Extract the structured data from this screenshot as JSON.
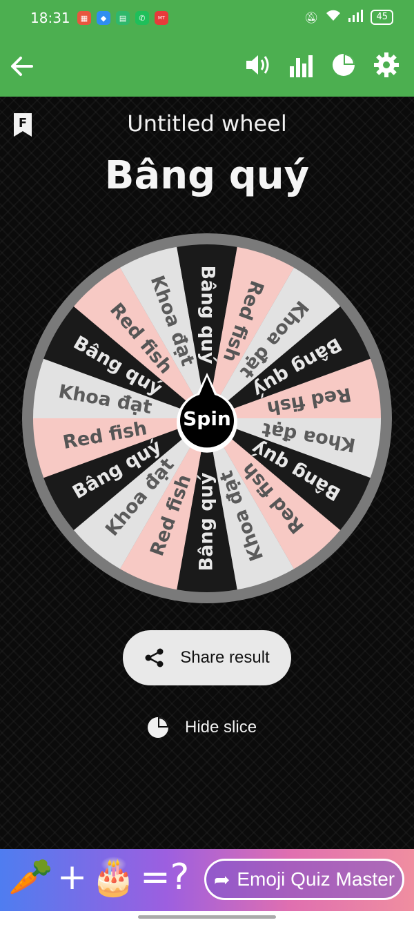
{
  "status_bar": {
    "time": "18:31",
    "battery": "45",
    "notification_icons": [
      "photos-icon",
      "browser-icon",
      "app-icon",
      "phone-icon",
      "mangatoon-icon"
    ]
  },
  "app_bar": {
    "back_icon": "arrow-left-icon",
    "actions": [
      "volume-icon",
      "stats-icon",
      "pie-chart-icon",
      "settings-icon"
    ],
    "color": "#4caf50"
  },
  "wheel": {
    "title": "Untitled wheel",
    "result": "Bâng quý",
    "spin_label": "Spin",
    "bookmark_letter": "F",
    "slice_labels": [
      "Bâng quý",
      "Red fish",
      "Khoa đạt"
    ],
    "slice_colors": {
      "Bâng quý": "#1a1a1a",
      "Red fish": "#f7c9c4",
      "Khoa đạt": "#e2e2e2"
    },
    "slice_count": 18
  },
  "actions": {
    "share_label": "Share result",
    "hide_slice_label": "Hide slice"
  },
  "ad": {
    "equation_symbols": [
      "+",
      "=?"
    ],
    "cta_label": "Emoji Quiz Master"
  }
}
